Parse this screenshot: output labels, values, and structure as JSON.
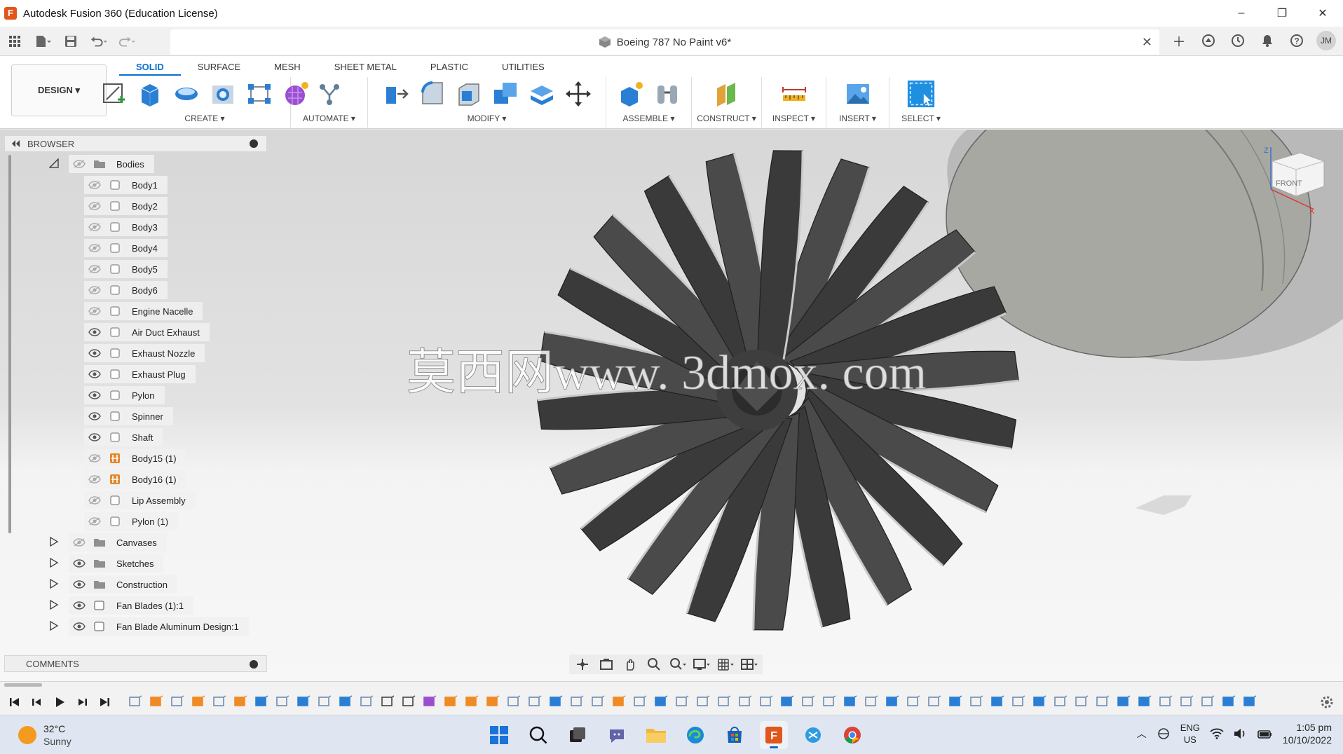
{
  "window": {
    "title": "Autodesk Fusion 360 (Education License)",
    "minimize": "–",
    "maximize": "❐",
    "close": "✕"
  },
  "document": {
    "title": "Boeing 787 No Paint v6*",
    "close": "✕"
  },
  "user": {
    "initials": "JM"
  },
  "ribbon": {
    "workspace": "DESIGN ▾",
    "tabs": [
      "SOLID",
      "SURFACE",
      "MESH",
      "SHEET METAL",
      "PLASTIC",
      "UTILITIES"
    ],
    "active_tab": "SOLID",
    "groups": {
      "create": "CREATE ▾",
      "automate": "AUTOMATE ▾",
      "modify": "MODIFY ▾",
      "assemble": "ASSEMBLE ▾",
      "construct": "CONSTRUCT ▾",
      "inspect": "INSPECT ▾",
      "insert": "INSERT ▾",
      "select": "SELECT ▾"
    }
  },
  "browser": {
    "title": "BROWSER",
    "bodies_folder": "Bodies",
    "bodies": [
      "Body1",
      "Body2",
      "Body3",
      "Body4",
      "Body5",
      "Body6",
      "Engine Nacelle",
      "Air Duct Exhaust",
      "Exhaust Nozzle",
      "Exhaust Plug",
      "Pylon",
      "Spinner",
      "Shaft",
      "Body15 (1)",
      "Body16 (1)",
      "Lip Assembly",
      "Pylon (1)"
    ],
    "folders": [
      "Canvases",
      "Sketches",
      "Construction"
    ],
    "components": [
      "Fan Blades (1):1",
      "Fan Blade Aluminum Design:1"
    ]
  },
  "comments": {
    "title": "COMMENTS"
  },
  "viewcube": {
    "front": "FRONT",
    "axis_z": "Z",
    "axis_x": "X"
  },
  "watermark": "莫西网www. 3dmox. com",
  "taskbar": {
    "temperature": "32°C",
    "condition": "Sunny",
    "lang_top": "ENG",
    "lang_bottom": "US",
    "time": "1:05 pm",
    "date": "10/10/2022",
    "fusion_letter": "F"
  },
  "colors": {
    "accent": "#0a6fcf",
    "fusion_orange": "#e0561b",
    "blade_dark": "#3b3b3b"
  }
}
